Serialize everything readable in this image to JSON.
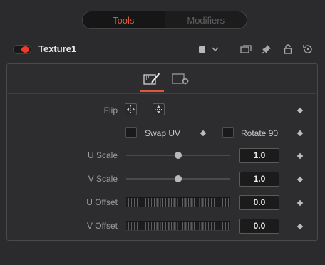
{
  "tabs": {
    "tools": "Tools",
    "modifiers": "Modifiers"
  },
  "tool": {
    "name": "Texture1",
    "power_color": "#ee3b2b"
  },
  "header_icons": [
    "color-swatch-icon",
    "chevron-down-icon",
    "version-icon",
    "pin-icon",
    "lock-icon",
    "reset-icon"
  ],
  "subtabs": [
    "controls-icon",
    "settings-icon"
  ],
  "controls": {
    "flip_label": "Flip",
    "swap_uv_label": "Swap UV",
    "rotate_label": "Rotate 90",
    "u_scale_label": "U Scale",
    "u_scale_value": "1.0",
    "v_scale_label": "V Scale",
    "v_scale_value": "1.0",
    "u_offset_label": "U Offset",
    "u_offset_value": "0.0",
    "v_offset_label": "V Offset",
    "v_offset_value": "0.0"
  },
  "colors": {
    "accent": "#e0573f",
    "background": "#2b2b2d"
  }
}
